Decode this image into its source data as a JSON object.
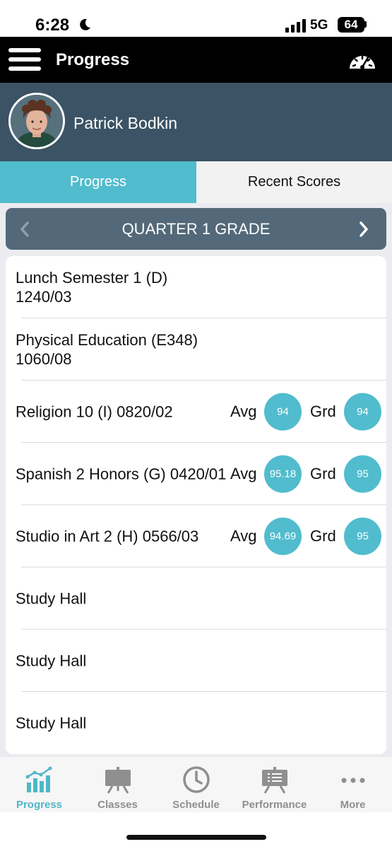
{
  "status_bar": {
    "time": "6:28",
    "network": "5G",
    "battery": "64"
  },
  "header": {
    "title": "Progress",
    "menu_icon": "hamburger-menu-icon",
    "right_icon": "speedometer-gauge-icon"
  },
  "profile": {
    "name": "Patrick Bodkin"
  },
  "tabs": [
    {
      "label": "Progress",
      "active": true
    },
    {
      "label": "Recent Scores",
      "active": false
    }
  ],
  "period": {
    "title": "QUARTER 1 GRADE"
  },
  "score_labels": {
    "avg": "Avg",
    "grd": "Grd"
  },
  "courses": [
    {
      "name": "Lunch Semester 1 (D) 1240/03"
    },
    {
      "name": "Physical Education (E348) 1060/08"
    },
    {
      "name": "Religion 10 (I) 0820/02",
      "avg": "94",
      "grd": "94"
    },
    {
      "name": "Spanish 2 Honors (G) 0420/01",
      "avg": "95.18",
      "grd": "95"
    },
    {
      "name": "Studio in Art 2 (H) 0566/03",
      "avg": "94.69",
      "grd": "95"
    },
    {
      "name": "Study Hall"
    },
    {
      "name": "Study Hall"
    },
    {
      "name": "Study Hall"
    }
  ],
  "bottom_nav": [
    {
      "label": "Progress",
      "icon": "bar-chart-icon",
      "active": true
    },
    {
      "label": "Classes",
      "icon": "easel-icon",
      "active": false
    },
    {
      "label": "Schedule",
      "icon": "clock-icon",
      "active": false
    },
    {
      "label": "Performance",
      "icon": "presentation-board-icon",
      "active": false
    },
    {
      "label": "More",
      "icon": "more-dots-icon",
      "active": false
    }
  ],
  "colors": {
    "accent": "#51bccd",
    "header_bg": "#000000",
    "profile_bg": "#3b5365",
    "period_bar_bg": "#536979",
    "nav_active": "#4fb7c8",
    "nav_inactive": "#8f8f8f"
  }
}
